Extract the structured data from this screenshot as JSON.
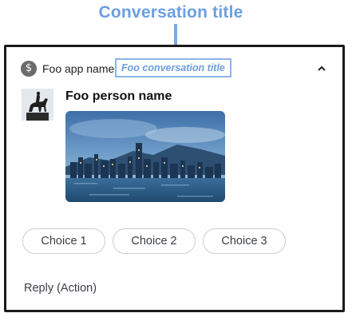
{
  "annotation": {
    "label": "Conversation title",
    "color": "#6b9fe0"
  },
  "notification": {
    "app_icon_glyph": "$",
    "app_name": "Foo app name",
    "conversation_title": "Foo conversation title",
    "expand_icon": "chevron-up-icon",
    "person_name": "Foo person name",
    "choices": [
      "Choice 1",
      "Choice 2",
      "Choice 3"
    ],
    "reply_action": "Reply (Action)"
  }
}
